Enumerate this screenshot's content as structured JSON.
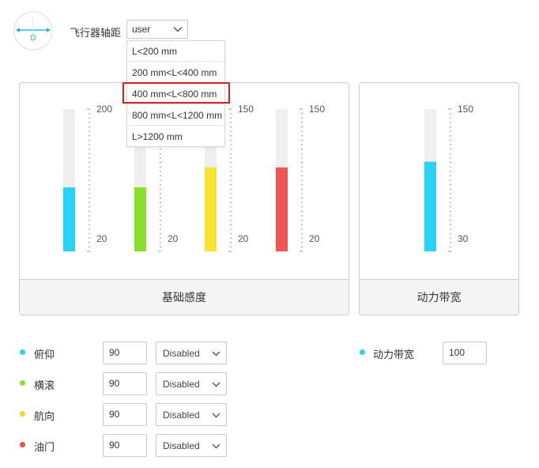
{
  "header": {
    "size_label": "飞行器轴距",
    "size_select": {
      "value": "user",
      "icon": "chevron-down-icon"
    },
    "size_options": [
      "L<200 mm",
      "200 mm<L<400 mm",
      "400 mm<L<800 mm",
      "800 mm<L<1200 mm",
      "L>1200 mm"
    ],
    "highlighted_option": "400 mm<L<800 mm",
    "logo_letter": "D"
  },
  "colors": {
    "pitch": "#29d3f5",
    "roll": "#89e02c",
    "yaw": "#f7e431",
    "throttle": "#f25454",
    "bandwidth": "#29d3f5",
    "track": "#efefef",
    "highlight": "#e31b1b"
  },
  "gain_panel": {
    "title": "基础感度",
    "gauges": [
      {
        "name": "pitch",
        "max_label": "200",
        "min_label": "20",
        "fill_fraction": 0.45
      },
      {
        "name": "roll",
        "max_label": "",
        "min_label": "20",
        "fill_fraction": 0.45
      },
      {
        "name": "yaw",
        "max_label": "150",
        "min_label": "20",
        "fill_fraction": 0.59
      },
      {
        "name": "throttle",
        "max_label": "150",
        "min_label": "20",
        "fill_fraction": 0.59
      }
    ]
  },
  "bandwidth_panel": {
    "title": "动力带宽",
    "gauge": {
      "max_label": "150",
      "min_label": "30",
      "fill_fraction": 0.63
    }
  },
  "controls": [
    {
      "label": "俯仰",
      "value": "90",
      "mode": "Disabled",
      "dot": "#29d3f5"
    },
    {
      "label": "横滚",
      "value": "90",
      "mode": "Disabled",
      "dot": "#89e02c"
    },
    {
      "label": "航向",
      "value": "90",
      "mode": "Disabled",
      "dot": "#f7d431"
    },
    {
      "label": "油门",
      "value": "90",
      "mode": "Disabled",
      "dot": "#f24949"
    }
  ],
  "bandwidth_control": {
    "label": "动力带宽",
    "value": "100",
    "dot": "#29d3f5"
  }
}
